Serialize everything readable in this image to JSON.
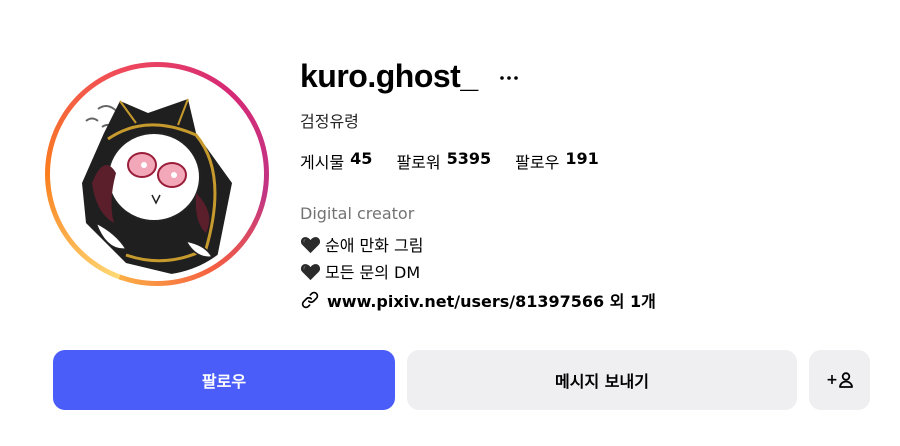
{
  "profile": {
    "username": "kuro.ghost_",
    "full_name": "검정유령",
    "stats": [
      {
        "label": "게시물",
        "value": "45"
      },
      {
        "label": "팔로워",
        "value": "5395"
      },
      {
        "label": "팔로우",
        "value": "191"
      }
    ],
    "category": "Digital creator",
    "bio_lines": [
      "순애 만화 그림",
      "모든 문의 DM"
    ],
    "link_text": "www.pixiv.net/users/81397566 외 1개"
  },
  "actions": {
    "follow_label": "팔로우",
    "message_label": "메시지 보내기",
    "suggest_label": "+"
  },
  "icons": {
    "more": "more-horizontal-icon",
    "heart": "black-heart-icon",
    "link": "link-icon",
    "suggest": "add-person-icon"
  },
  "colors": {
    "follow_button": "#4a5df9",
    "secondary_button": "#efeff2",
    "category_text": "#737373"
  }
}
